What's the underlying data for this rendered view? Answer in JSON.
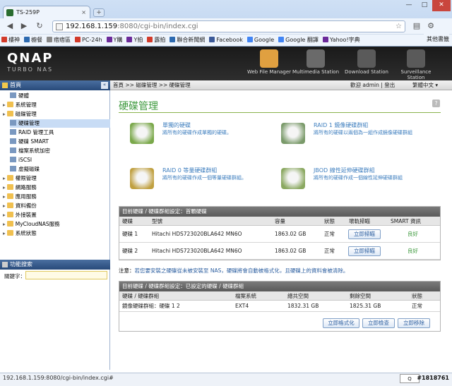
{
  "browser": {
    "tab_title": "TS-259P",
    "tab_close": "×",
    "new_tab": "+",
    "window_controls": {
      "minimize": "—",
      "maximize": "□",
      "close": "✕"
    },
    "url_host": "192.168.1.159",
    "url_path": ":8080/cgi-bin/index.cgi",
    "back": "◀",
    "forward": "▶",
    "reload": "↻",
    "page_icon": "page-icon",
    "star": "☆",
    "bookmarks": [
      {
        "label": "樓神",
        "color": "#d23a2a"
      },
      {
        "label": "櫥餐",
        "color": "#2d6ab0"
      },
      {
        "label": "痞痞區",
        "color": "#888888"
      },
      {
        "label": "PC-24h",
        "color": "#d23a2a"
      },
      {
        "label": "Y購",
        "color": "#6b2a9a"
      },
      {
        "label": "Y拍",
        "color": "#6b2a9a"
      },
      {
        "label": "露拍",
        "color": "#d23a2a"
      },
      {
        "label": "聯合新聞網",
        "color": "#2d6ab0"
      },
      {
        "label": "Facebook",
        "color": "#3b5998"
      },
      {
        "label": "Google",
        "color": "#4285f4"
      },
      {
        "label": "Google 翻譯",
        "color": "#4285f4"
      },
      {
        "label": "Yahoo!字典",
        "color": "#6b2a9a"
      }
    ],
    "other_bookmarks": "其他書籤",
    "status_url": "192.168.1.159:8080/cgi-bin/index.cgi#",
    "watermark": "#1818761"
  },
  "qnap": {
    "logo": "QNAP",
    "sub": "TURBO NAS",
    "stations": [
      {
        "label": "Web File Manager",
        "color": "#e0a040"
      },
      {
        "label": "Multimedia Station",
        "color": "#6a6a6a"
      },
      {
        "label": "Download Station",
        "color": "#5a5a5a"
      },
      {
        "label": "Surveillance Station",
        "color": "#5a5a5a"
      }
    ]
  },
  "sidebar": {
    "header": "首頁",
    "collapse": "«",
    "items": [
      {
        "label": "硬體",
        "level": 1
      },
      {
        "label": "系統管理",
        "level": 0
      },
      {
        "label": "磁碟管理",
        "level": 0
      },
      {
        "label": "硬碟管理",
        "level": 1,
        "selected": true
      },
      {
        "label": "RAID 管理工具",
        "level": 1
      },
      {
        "label": "硬碟 SMART",
        "level": 1
      },
      {
        "label": "檔案系統加密",
        "level": 1
      },
      {
        "label": "iSCSI",
        "level": 1
      },
      {
        "label": "虛擬磁碟",
        "level": 1
      },
      {
        "label": "權限管理",
        "level": 0
      },
      {
        "label": "網路服務",
        "level": 0
      },
      {
        "label": "應用服務",
        "level": 0
      },
      {
        "label": "資料備份",
        "level": 0
      },
      {
        "label": "外接裝置",
        "level": 0
      },
      {
        "label": "MyCloudNAS服務",
        "level": 0
      },
      {
        "label": "系統狀態",
        "level": 0
      }
    ],
    "function_search": "功能搜索",
    "keyword_label": "關鍵字："
  },
  "main": {
    "breadcrumb": "首頁 >> 磁碟管理 >> 硬碟管理",
    "welcome": "歡迎 admin",
    "separator": "|",
    "logout": "登出",
    "language": "繁體中文",
    "help": "?",
    "page_title": "硬碟管理",
    "options": [
      {
        "title": "單獨的硬碟",
        "desc": "將所有的硬碟作成單獨的硬碟。",
        "color": "#7aa84a"
      },
      {
        "title": "RAID 1 鏡像硬碟群組",
        "desc": "將所有的硬碟以兩個為一組作成鏡像硬碟群組",
        "color": "#7a9a6a"
      },
      {
        "title": "RAID 0 等量硬碟群組",
        "desc": "將所有的硬碟作成一個等量硬碟群組。",
        "color": "#c0a040"
      },
      {
        "title": "JBOD 線性延伸硬碟群組",
        "desc": "將所有的硬碟作成一個線性延伸硬碟群組",
        "color": "#8aa860"
      }
    ],
    "table1": {
      "title": "目前硬碟 / 硬碟群組設定：首顆硬碟",
      "headers": [
        "硬碟",
        "型號",
        "容量",
        "狀態",
        "壞軌掃瞄",
        "SMART 資訊"
      ],
      "rows": [
        {
          "disk": "硬碟 1",
          "model": "Hitachi HDS723020BLA642 MN6O",
          "capacity": "1863.02 GB",
          "status": "正常",
          "action": "立即掃瞄",
          "smart": "良好"
        },
        {
          "disk": "硬碟 2",
          "model": "Hitachi HDS723020BLA642 MN6O",
          "capacity": "1863.02 GB",
          "status": "正常",
          "action": "立即掃瞄",
          "smart": "良好"
        }
      ]
    },
    "note_label": "注意：",
    "note_text": "若您要安裝之硬碟從未被安裝至 NAS，硬碟將會自動被格式化，且硬碟上的資料會被清除。",
    "table2": {
      "title": "目前硬碟 / 硬碟群組設定：已設定的硬碟 / 硬碟群組",
      "headers": [
        "硬碟 / 硬碟群組",
        "檔案系統",
        "總共空間",
        "剩餘空間",
        "狀態"
      ],
      "rows": [
        {
          "group": "鏡像硬碟群組：硬碟 1 2",
          "fs": "EXT4",
          "total": "1832.31 GB",
          "free": "1825.31 GB",
          "status": "正常"
        }
      ],
      "buttons": [
        "立即格式化",
        "立即檢查",
        "立即移除"
      ]
    }
  }
}
